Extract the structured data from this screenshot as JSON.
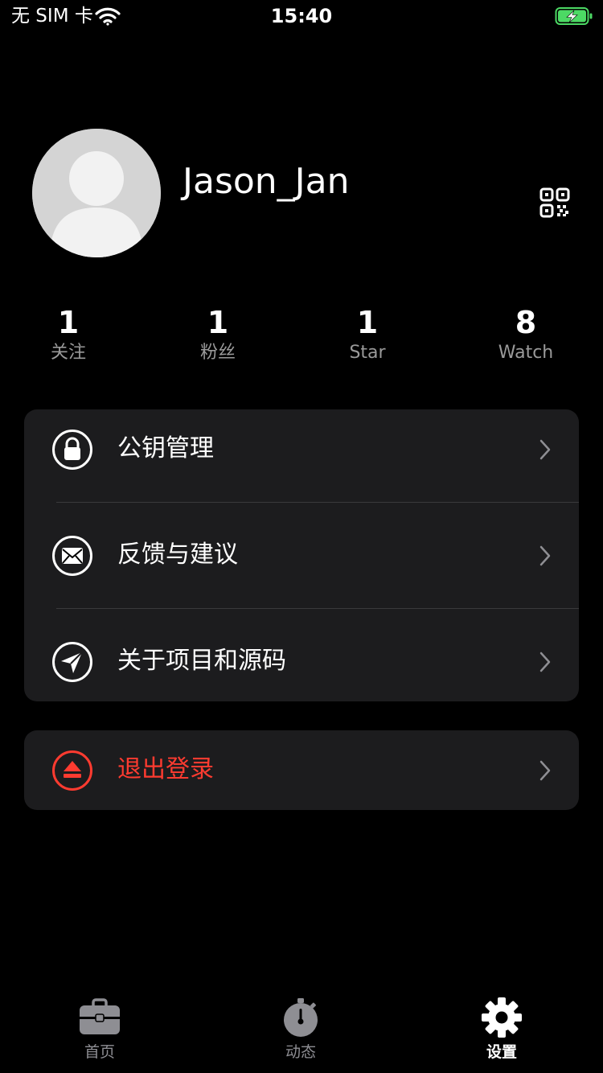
{
  "status_bar": {
    "carrier": "无 SIM 卡",
    "time": "15:40",
    "wifi_icon": "wifi-icon",
    "battery_icon": "battery-charging-icon"
  },
  "profile": {
    "username": "Jason_Jan",
    "avatar_icon": "default-avatar",
    "qr_icon": "qr-code-icon"
  },
  "stats": [
    {
      "value": "1",
      "label": "关注"
    },
    {
      "value": "1",
      "label": "粉丝"
    },
    {
      "value": "1",
      "label": "Star"
    },
    {
      "value": "8",
      "label": "Watch"
    }
  ],
  "menu": {
    "items": [
      {
        "label": "公钥管理",
        "icon": "lock-icon"
      },
      {
        "label": "反馈与建议",
        "icon": "mail-icon"
      },
      {
        "label": "关于项目和源码",
        "icon": "send-icon"
      }
    ]
  },
  "logout": {
    "label": "退出登录",
    "icon": "eject-icon",
    "color": "#ff3b30"
  },
  "tabbar": {
    "tabs": [
      {
        "label": "首页",
        "icon": "briefcase-icon"
      },
      {
        "label": "动态",
        "icon": "stopwatch-icon"
      },
      {
        "label": "设置",
        "icon": "gear-icon",
        "active": true
      }
    ]
  },
  "colors": {
    "background": "#000000",
    "card": "#1c1c1e",
    "separator": "#3a3a3c",
    "secondary_text": "#9a9a9a",
    "danger": "#ff3b30",
    "battery_charging": "#4cd964"
  }
}
